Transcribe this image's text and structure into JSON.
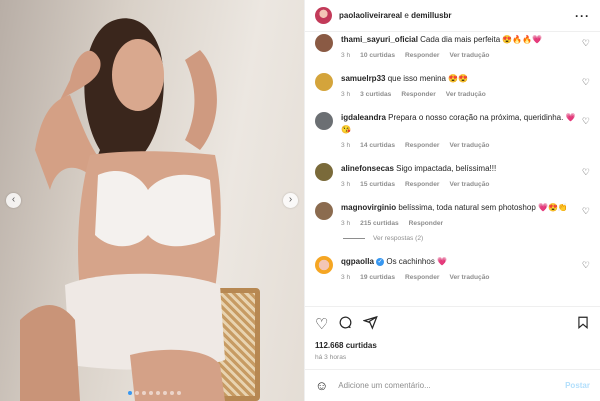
{
  "post": {
    "author": "paolaoliveirareal",
    "connector": "e",
    "coauthor": "demillusbr",
    "likes": "112.668 curtidas",
    "time": "há 3 horas",
    "carousel_index": 1,
    "carousel_total": 8
  },
  "comments": [
    {
      "user": "thami_sayuri_oficial",
      "text": "Cada dia mais perfeita 😍🔥🔥💗",
      "time": "3 h",
      "likes": "10 curtidas",
      "reply": "Responder",
      "translate": "Ver tradução"
    },
    {
      "user": "samuelrp33",
      "text": "que isso menina 😍😍",
      "time": "3 h",
      "likes": "3 curtidas",
      "reply": "Responder",
      "translate": "Ver tradução"
    },
    {
      "user": "igdaleandra",
      "text": "Prepara o nosso coração na próxima, queridinha. 💗😘",
      "time": "3 h",
      "likes": "14 curtidas",
      "reply": "Responder",
      "translate": "Ver tradução"
    },
    {
      "user": "alinefonsecas",
      "text": "Sigo impactada, belíssima!!!",
      "time": "3 h",
      "likes": "15 curtidas",
      "reply": "Responder",
      "translate": "Ver tradução"
    },
    {
      "user": "magnovirginio",
      "text": "belíssima, toda natural sem photoshop 💗😍👏",
      "time": "3 h",
      "likes": "215 curtidas",
      "reply": "Responder",
      "translate": ""
    },
    {
      "user": "qgpaolla",
      "text": "Os cachinhos 💗",
      "time": "3 h",
      "likes": "19 curtidas",
      "reply": "Responder",
      "translate": "Ver tradução"
    }
  ],
  "view_replies": "Ver respostas (2)",
  "add_comment_placeholder": "Adicione um comentário...",
  "post_button": "Postar",
  "icons": {
    "like": "heart-icon",
    "comment": "comment-icon",
    "share": "send-icon",
    "save": "bookmark-icon",
    "emoji": "emoji-icon",
    "more": "more-icon"
  }
}
